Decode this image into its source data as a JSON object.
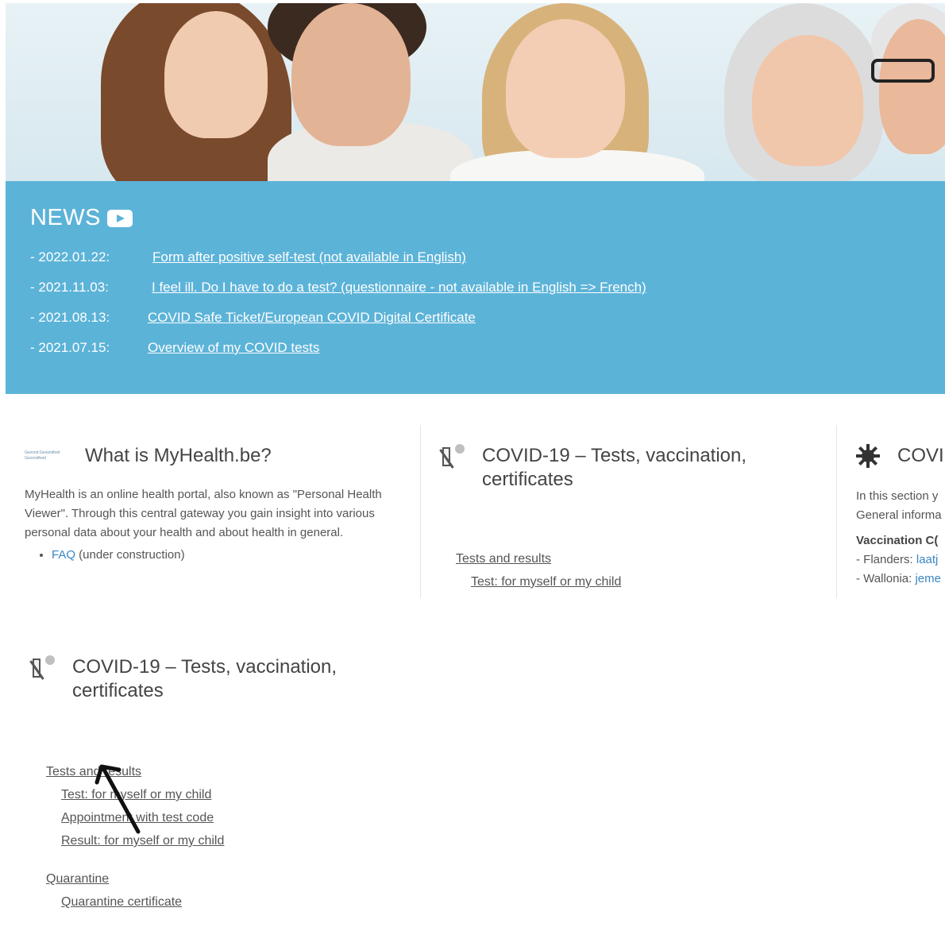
{
  "news": {
    "title": "NEWS",
    "items": [
      {
        "date": "- 2022.01.22:",
        "link": "Form after positive self-test (not available in English)"
      },
      {
        "date": "- 2021.11.03:",
        "link": "I feel ill. Do I have to do a test? (questionnaire - not available in English => French)"
      },
      {
        "date": "- 2021.08.13:",
        "link": "COVID Safe Ticket/European COVID Digital Certificate"
      },
      {
        "date": "- 2021.07.15:",
        "link": "Overview of my COVID tests"
      }
    ]
  },
  "card_myhealth": {
    "logo_text": "Gezond Gesundheit Gezondheid",
    "title": "What is MyHealth.be?",
    "body": "MyHealth is an online health portal, also known as \"Personal Health Viewer\". Through this central gateway you gain insight into various personal data about your health and about health in general.",
    "faq_link": "FAQ",
    "faq_note": " (under construction)"
  },
  "card_covid": {
    "title": "COVID-19 – Tests, vaccination, certificates",
    "tests_link": "Tests and results",
    "test_myself_link": "Test: for myself or my child"
  },
  "card_covid_vacc": {
    "title": "COVI",
    "intro_1": "In this section y",
    "intro_2": "General informa",
    "vacc_heading": "Vaccination C(",
    "flanders_label": "- Flanders: ",
    "flanders_link": "laatj",
    "wallonia_label": "- Wallonia: ",
    "wallonia_link": "jeme"
  },
  "lower": {
    "title": "COVID-19 – Tests, vaccination, certificates",
    "tests_link": "Tests and results",
    "test_myself_link": "Test: for myself or my child",
    "appointment_link": "Appointment with test code",
    "result_link": "Result: for myself or my child",
    "quarantine_link": "Quarantine",
    "quarantine_cert_link": "Quarantine certificate"
  },
  "colors": {
    "news_bg": "#5cb3d8",
    "link_blue": "#3a87c3",
    "text_gray": "#555555"
  },
  "icons": [
    "youtube-icon",
    "myhealth-logo",
    "vaccine-icon",
    "virus-icon",
    "arrow-annotation"
  ]
}
